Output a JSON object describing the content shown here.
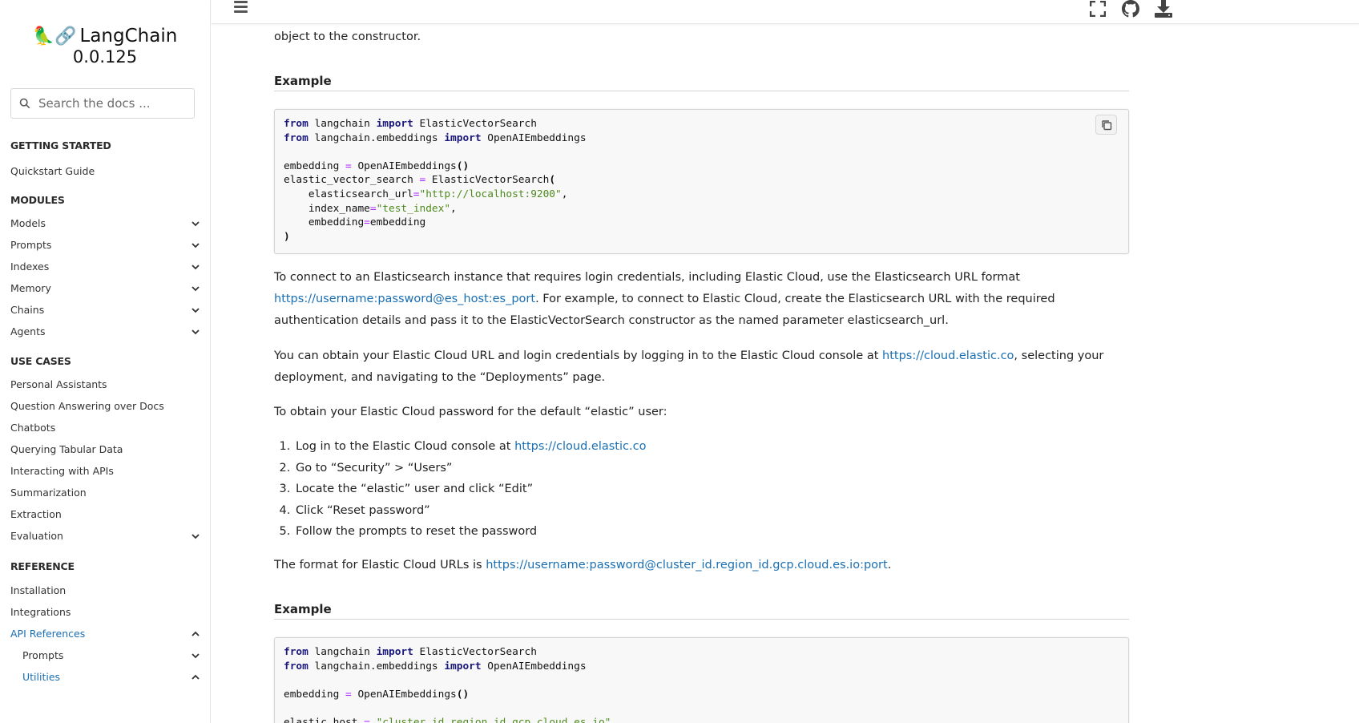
{
  "brand": {
    "logo": "🦜🔗",
    "name": "LangChain",
    "version": "0.0.125"
  },
  "search": {
    "placeholder": "Search the docs ..."
  },
  "nav": {
    "getting_started": {
      "caption": "GETTING STARTED",
      "items": [
        "Quickstart Guide"
      ]
    },
    "modules": {
      "caption": "MODULES",
      "items": [
        "Models",
        "Prompts",
        "Indexes",
        "Memory",
        "Chains",
        "Agents"
      ]
    },
    "use_cases": {
      "caption": "USE CASES",
      "items": [
        "Personal Assistants",
        "Question Answering over Docs",
        "Chatbots",
        "Querying Tabular Data",
        "Interacting with APIs",
        "Summarization",
        "Extraction",
        "Evaluation"
      ]
    },
    "reference": {
      "caption": "REFERENCE",
      "items": [
        "Installation",
        "Integrations",
        "API References",
        "Prompts",
        "Utilities"
      ]
    }
  },
  "header": {
    "icons": [
      "fullscreen-icon",
      "github-icon",
      "download-icon"
    ],
    "menu_icon": "hamburger-icon"
  },
  "content": {
    "intro_tail": "object to the constructor.",
    "example_heading_1": "Example",
    "code1": {
      "l1_kw1": "from",
      "l1_mod": " langchain ",
      "l1_kw2": "import",
      "l1_name": " ElasticVectorSearch",
      "l2_kw1": "from",
      "l2_mod": " langchain.embeddings ",
      "l2_kw2": "import",
      "l2_name": " OpenAIEmbeddings",
      "l4_a": "embedding ",
      "l4_op": "=",
      "l4_b": " OpenAIEmbeddings",
      "l4_c": "()",
      "l5_a": "elastic_vector_search ",
      "l5_op": "=",
      "l5_b": " ElasticVectorSearch",
      "l5_c": "(",
      "l6_a": "    elasticsearch_url",
      "l6_op": "=",
      "l6_str": "\"http://localhost:9200\"",
      "l6_c": ",",
      "l7_a": "    index_name",
      "l7_op": "=",
      "l7_str": "\"test_index\"",
      "l7_c": ",",
      "l8_a": "    embedding",
      "l8_op": "=",
      "l8_b": "embedding",
      "l9": ")"
    },
    "p1_a": "To connect to an Elasticsearch instance that requires login credentials, including Elastic Cloud, use the Elasticsearch URL format",
    "p1_link": "https://username:password@es_host:es_port",
    "p1_b": ". For example, to connect to Elastic Cloud, create the Elasticsearch URL with the required authentication details and pass it to the ElasticVectorSearch constructor as the named parameter elasticsearch_url.",
    "p2_a": "You can obtain your Elastic Cloud URL and login credentials by logging in to the Elastic Cloud console at ",
    "p2_link": "https://cloud.elastic.co",
    "p2_b": ", selecting your deployment, and navigating to the “Deployments” page.",
    "p3": "To obtain your Elastic Cloud password for the default “elastic” user:",
    "steps": {
      "s1_a": "Log in to the Elastic Cloud console at ",
      "s1_link": "https://cloud.elastic.co",
      "s2": "Go to “Security” > “Users”",
      "s3": "Locate the “elastic” user and click “Edit”",
      "s4": "Click “Reset password”",
      "s5": "Follow the prompts to reset the password"
    },
    "p4_a": "The format for Elastic Cloud URLs is ",
    "p4_link": "https://username:password@cluster_id.region_id.gcp.cloud.es.io:port",
    "p4_b": ".",
    "example_heading_2": "Example",
    "code2": {
      "l1_kw1": "from",
      "l1_mod": " langchain ",
      "l1_kw2": "import",
      "l1_name": " ElasticVectorSearch",
      "l2_kw1": "from",
      "l2_mod": " langchain.embeddings ",
      "l2_kw2": "import",
      "l2_name": " OpenAIEmbeddings",
      "l4_a": "embedding ",
      "l4_op": "=",
      "l4_b": " OpenAIEmbeddings",
      "l4_c": "()",
      "l6_a": "elastic_host ",
      "l6_op": "=",
      "l6_str": " \"cluster_id.region_id.gcp.cloud.es.io\""
    }
  },
  "colors": {
    "link": "#1a6fb3",
    "keyword": "#19177c",
    "string": "#4e8a1c",
    "operator": "#aa22ff",
    "code_bg": "#f8f8f8"
  }
}
